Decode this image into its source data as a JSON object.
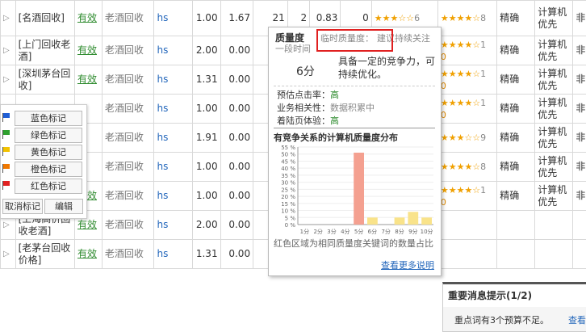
{
  "rows": [
    {
      "keyword": "[名酒回收]",
      "status": "有效",
      "plan": "老酒回收",
      "match": "hs",
      "bid": "1.00",
      "avg": "1.67",
      "c1": "21",
      "c2": "2",
      "ctr": "0.83",
      "cost": "0",
      "star": "★★★☆☆",
      "starnum": "6",
      "star2": "★★★★☆",
      "star2num": "8",
      "mode": "精确",
      "calc": "计算机优先",
      "last": "非"
    },
    {
      "keyword": "[上门回收老酒]",
      "status": "有效",
      "plan": "老酒回收",
      "match": "hs",
      "bid": "2.00",
      "avg": "0.00",
      "c1": "",
      "c2": "",
      "ctr": "",
      "cost": "",
      "star": "",
      "starnum": "",
      "star2": "★★★★☆",
      "star2num": "1",
      "star2num2": "0",
      "mode": "精确",
      "calc": "计算机优先",
      "last": "非"
    },
    {
      "keyword": "[深圳茅台回收]",
      "status": "有效",
      "plan": "老酒回收",
      "match": "hs",
      "bid": "1.31",
      "avg": "0.00",
      "c1": "",
      "c2": "",
      "ctr": "",
      "cost": "",
      "star": "",
      "starnum": "",
      "star2": "★★★★☆",
      "star2num": "1",
      "star2num2": "0",
      "mode": "精确",
      "calc": "计算机优先",
      "last": "非"
    },
    {
      "keyword": "",
      "status": "",
      "plan": "老酒回收",
      "match": "hs",
      "bid": "1.00",
      "avg": "0.00",
      "c1": "",
      "c2": "",
      "ctr": "",
      "cost": "",
      "star": "",
      "starnum": "",
      "star2": "★★★★☆",
      "star2num": "1",
      "star2num2": "0",
      "mode": "精确",
      "calc": "计算机优先",
      "last": "非"
    },
    {
      "keyword": "",
      "status": "",
      "plan": "老酒回收",
      "match": "hs",
      "bid": "1.91",
      "avg": "0.00",
      "c1": "",
      "c2": "",
      "ctr": "",
      "cost": "",
      "star": "",
      "starnum": "",
      "star2": "★★★☆☆",
      "star2num": "9",
      "mode": "精确",
      "calc": "计算机优先",
      "last": "非"
    },
    {
      "keyword": "",
      "status": "",
      "plan": "老酒回收",
      "match": "hs",
      "bid": "1.00",
      "avg": "0.00",
      "c1": "",
      "c2": "",
      "ctr": "",
      "cost": "",
      "star": "",
      "starnum": "",
      "star2": "★★★★☆",
      "star2num": "8",
      "mode": "精确",
      "calc": "计算机优先",
      "last": "非"
    },
    {
      "keyword": "[深圳高档洋酒回收]",
      "status": "有效",
      "plan": "老酒回收",
      "match": "hs",
      "bid": "1.00",
      "avg": "0.00",
      "c1": "",
      "c2": "",
      "ctr": "",
      "cost": "",
      "star": "",
      "starnum": "",
      "star2": "★★★★☆",
      "star2num": "1",
      "star2num2": "0",
      "mode": "精确",
      "calc": "计算机优先",
      "last": "非"
    },
    {
      "keyword": "[上海高价回收老酒]",
      "status": "有效",
      "plan": "老酒回收",
      "match": "hs",
      "bid": "2.00",
      "avg": "0.00",
      "c1": "0",
      "c2": "0",
      "ctr": "0.00",
      "cost": "0",
      "star": "★★★☆☆",
      "starnum": "6",
      "star2": "",
      "star2num": "",
      "mode": "",
      "calc": "",
      "last": ""
    },
    {
      "keyword": "[老茅台回收价格]",
      "status": "有效",
      "plan": "老酒回收",
      "match": "hs",
      "bid": "1.31",
      "avg": "0.00",
      "c1": "0",
      "c2": "0",
      "ctr": "0.00",
      "cost": "0",
      "star": "★★★☆☆",
      "starnum": "6",
      "star2": "",
      "star2num": "",
      "mode": "",
      "calc": "",
      "last": ""
    }
  ],
  "flags": [
    {
      "label": "蓝色标记",
      "color": "#1f5fd6"
    },
    {
      "label": "绿色标记",
      "color": "#2ea02e"
    },
    {
      "label": "黄色标记",
      "color": "#f2c200"
    },
    {
      "label": "橙色标记",
      "color": "#f07800"
    },
    {
      "label": "红色标记",
      "color": "#e02020"
    }
  ],
  "flag_actions": {
    "cancel": "取消标记",
    "edit": "编辑"
  },
  "popup": {
    "title": "质量度",
    "subtitle": "一段时间",
    "temp_label": "临时质量度：",
    "temp_value": "建议持续关注",
    "score": "6分",
    "score_desc": "具备一定的竞争力，可持续优化。",
    "metrics": [
      {
        "label": "预估点击率：",
        "value": "高",
        "grey": false
      },
      {
        "label": "业务相关性：",
        "value": "数据积累中",
        "grey": true
      },
      {
        "label": "着陆页体验：",
        "value": "高",
        "grey": false
      }
    ],
    "chart_title": "有竞争关系的计算机质量度分布",
    "caption": "红色区域为相同质量度关键词的数量占比",
    "more_link": "查看更多说明"
  },
  "chart_data": {
    "type": "bar",
    "title": "有竞争关系的计算机质量度分布",
    "categories": [
      "1分",
      "2分",
      "3分",
      "4分",
      "5分",
      "6分",
      "7分",
      "8分",
      "9分",
      "10分"
    ],
    "values": [
      0,
      0,
      0,
      0,
      51,
      5,
      0,
      5,
      9,
      5
    ],
    "highlight_index": 4,
    "highlight_color": "#f4a090",
    "bar_color": "#f9e38a",
    "ylim": [
      0,
      55
    ],
    "yticks": [
      "0 %",
      "5 %",
      "10 %",
      "15 %",
      "20 %",
      "25 %",
      "30 %",
      "35 %",
      "40 %",
      "45 %",
      "50 %",
      "55 %"
    ],
    "ytick_values": [
      0,
      5,
      10,
      15,
      20,
      25,
      30,
      35,
      40,
      45,
      50,
      55
    ],
    "grid": true
  },
  "notice": {
    "title": "重要消息提示(1/2)",
    "content": "重点词有3个预算不足。",
    "link": "查看"
  },
  "colors": {
    "link": "#2266bb",
    "status": "#2e8b2e",
    "highlight_box": "#e02020"
  }
}
